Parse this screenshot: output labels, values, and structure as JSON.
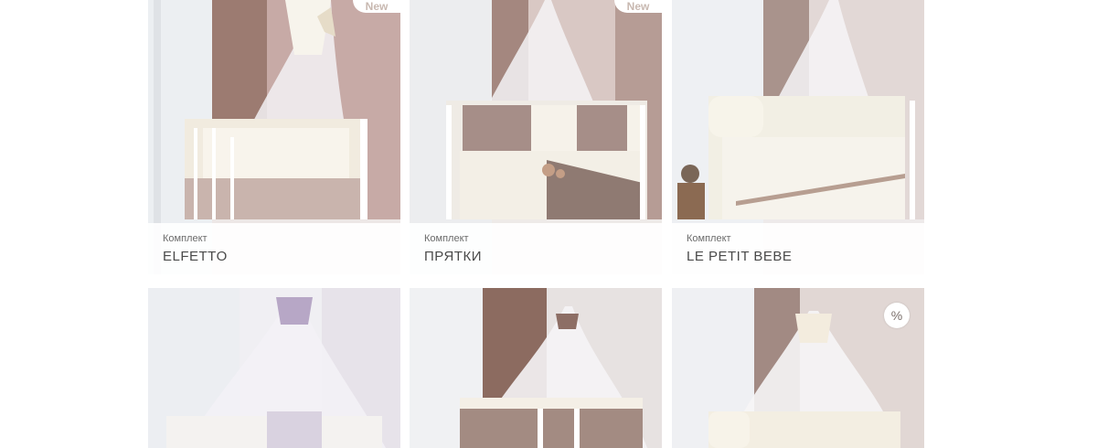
{
  "products": [
    {
      "type": "Комплект",
      "title": "ELFETTO",
      "badge": "New"
    },
    {
      "type": "Комплект",
      "title": "ПРЯТКИ",
      "badge": "New"
    },
    {
      "type": "Комплект",
      "title": "LE PETIT BEBE",
      "badge": ""
    },
    {
      "type": "",
      "title": "",
      "badge": ""
    },
    {
      "type": "",
      "title": "",
      "badge": ""
    },
    {
      "type": "",
      "title": "",
      "badge": "%"
    }
  ],
  "colors": {
    "wall_pink": "#c9b1ad",
    "curtain_brown": "#8a6f66",
    "tulle": "#f5f3f6",
    "bedding_cream": "#f2ede3",
    "bedding_taupe": "#9e8880",
    "bedding_lilac": "#cbc2d4"
  },
  "icons": [
    "crib-photo-image",
    "canopy-image"
  ]
}
